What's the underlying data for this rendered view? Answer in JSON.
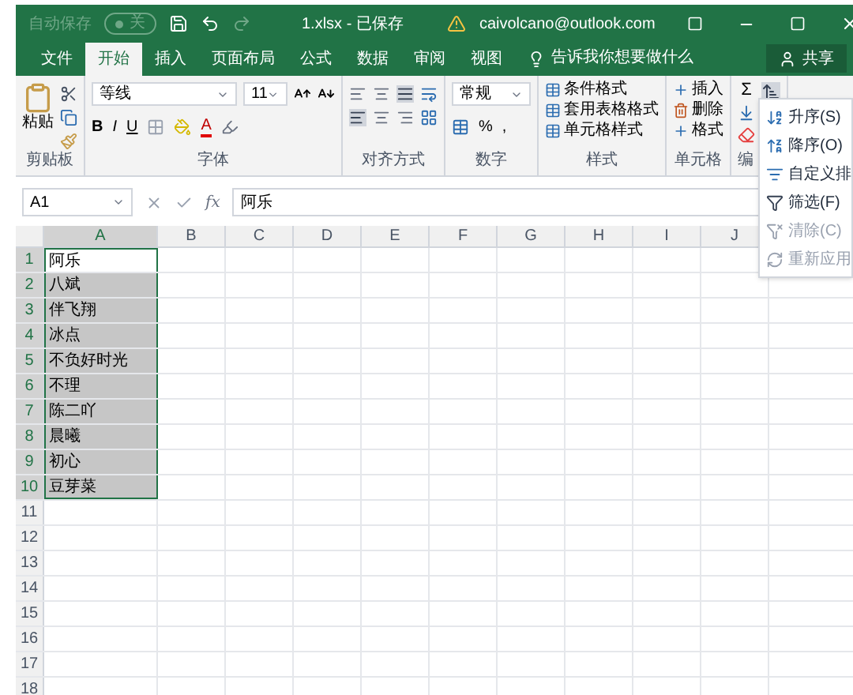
{
  "title_bar": {
    "autosave": "自动保存",
    "autosave_toggle": "关",
    "title": "1.xlsx - 已保存",
    "account": "caivolcano@outlook.com"
  },
  "tabs": [
    {
      "label": "文件",
      "selected": false
    },
    {
      "label": "开始",
      "selected": true
    },
    {
      "label": "插入",
      "selected": false
    },
    {
      "label": "页面布局",
      "selected": false
    },
    {
      "label": "公式",
      "selected": false
    },
    {
      "label": "数据",
      "selected": false
    },
    {
      "label": "审阅",
      "selected": false
    },
    {
      "label": "视图",
      "selected": false
    }
  ],
  "tell_me": "告诉我你想要做什么",
  "share": "共享",
  "ribbon": [
    {
      "kind": "clipboard",
      "label": "剪贴板",
      "paste": "粘贴"
    },
    {
      "kind": "font",
      "label": "字体",
      "font_name": "等线",
      "font_size": "11",
      "bold": "B",
      "italic": "I",
      "underline": "U",
      "font_color": "A"
    },
    {
      "kind": "alignment",
      "label": "对齐方式"
    },
    {
      "kind": "number",
      "label": "数字",
      "format": "常规",
      "percent": "%",
      "comma": ","
    },
    {
      "kind": "styles",
      "label": "样式",
      "items": [
        "条件格式",
        "套用表格格式",
        "单元格样式"
      ]
    },
    {
      "kind": "cells",
      "label": "单元格",
      "items": [
        "插入",
        "删除",
        "格式"
      ]
    },
    {
      "kind": "editing",
      "label": "编",
      "sum": "Σ"
    }
  ],
  "sort_menu": [
    {
      "label": "升序(S)",
      "disabled": false
    },
    {
      "label": "降序(O)",
      "disabled": false
    },
    {
      "label": "自定义排",
      "disabled": false
    },
    {
      "label": "筛选(F)",
      "disabled": false
    },
    {
      "label": "清除(C)",
      "disabled": true
    },
    {
      "label": "重新应用",
      "disabled": true
    }
  ],
  "formula_bar": {
    "name_box": "A1",
    "function_label": "fx",
    "formula": "阿乐"
  },
  "columns": [
    "A",
    "B",
    "C",
    "D",
    "E",
    "F",
    "G",
    "H",
    "I",
    "J"
  ],
  "rows": [
    {
      "number": "1",
      "value": "阿乐",
      "selected": true,
      "active": true
    },
    {
      "number": "2",
      "value": "八斌",
      "selected": true,
      "active": false
    },
    {
      "number": "3",
      "value": "伴飞翔",
      "selected": true,
      "active": false
    },
    {
      "number": "4",
      "value": "冰点",
      "selected": true,
      "active": false
    },
    {
      "number": "5",
      "value": "不负好时光",
      "selected": true,
      "active": false
    },
    {
      "number": "6",
      "value": "不理",
      "selected": true,
      "active": false
    },
    {
      "number": "7",
      "value": "陈二吖",
      "selected": true,
      "active": false
    },
    {
      "number": "8",
      "value": "晨曦",
      "selected": true,
      "active": false
    },
    {
      "number": "9",
      "value": "初心",
      "selected": true,
      "active": false
    },
    {
      "number": "10",
      "value": "豆芽菜",
      "selected": true,
      "active": false
    },
    {
      "number": "11",
      "selected": false,
      "active": false
    },
    {
      "number": "12",
      "selected": false,
      "active": false
    },
    {
      "number": "13",
      "selected": false,
      "active": false
    },
    {
      "number": "14",
      "selected": false,
      "active": false
    },
    {
      "number": "15",
      "selected": false,
      "active": false
    },
    {
      "number": "16",
      "selected": false,
      "active": false
    },
    {
      "number": "17",
      "selected": false,
      "active": false
    },
    {
      "number": "18",
      "selected": false,
      "active": false
    }
  ]
}
